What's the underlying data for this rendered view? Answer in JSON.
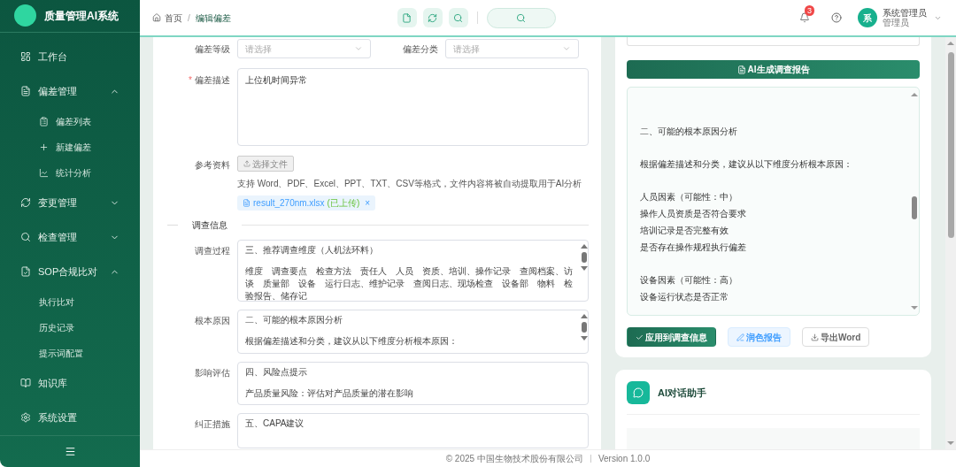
{
  "sidebar": {
    "title": "质量管理AI系统",
    "items": [
      {
        "label": "工作台"
      },
      {
        "label": "偏差管理",
        "expanded": true,
        "children": [
          {
            "label": "偏差列表"
          },
          {
            "label": "新建偏差"
          },
          {
            "label": "统计分析"
          }
        ]
      },
      {
        "label": "变更管理",
        "expanded": false
      },
      {
        "label": "检查管理",
        "expanded": false
      },
      {
        "label": "SOP合规比对",
        "expanded": true,
        "children": [
          {
            "label": "执行比对"
          },
          {
            "label": "历史记录"
          },
          {
            "label": "提示词配置"
          }
        ]
      },
      {
        "label": "知识库"
      },
      {
        "label": "系统设置"
      }
    ]
  },
  "header": {
    "breadcrumb": [
      "首页",
      "编辑偏差"
    ],
    "separator": "/",
    "notifications": "3",
    "user": {
      "avatar": "系",
      "name": "系统管理员",
      "role": "管理员"
    }
  },
  "form": {
    "selects": [
      {
        "label": "偏差等级",
        "placeholder": "请选择"
      },
      {
        "label": "偏差分类",
        "placeholder": "请选择"
      }
    ],
    "description": {
      "label": "偏差描述",
      "required_mark": "*",
      "value": "上位机时间异常"
    },
    "attachments": {
      "label": "参考资料",
      "button": "选择文件",
      "hint": "支持 Word、PDF、Excel、PPT、TXT、CSV等格式，文件内容将被自动提取用于AI分析",
      "file": "result_270nm.xlsx",
      "file_status": "(已上传)",
      "remove": "×"
    },
    "section": "调查信息",
    "fields": [
      {
        "label": "调查过程",
        "paragraphs": [
          "三、推荐调查维度（人机法环料）",
          "维度　调查要点　检查方法　责任人　人员　资质、培训、操作记录　查阅档案、访谈　质量部　设备　运行日志、维护记录　查阅日志、现场检查　设备部　物料　检验报告、储存记"
        ],
        "scrollbar": true
      },
      {
        "label": "根本原因",
        "paragraphs": [
          "二、可能的根本原因分析",
          "根据偏差描述和分类，建议从以下维度分析根本原因："
        ],
        "scrollbar": true
      },
      {
        "label": "影响评估",
        "paragraphs": [
          "四、风险点提示",
          "产品质量风险：评估对产品质量的潜在影响"
        ],
        "scrollbar": false
      },
      {
        "label": "纠正措施",
        "paragraphs": [
          "五、CAPA建议"
        ],
        "scrollbar": false
      }
    ]
  },
  "ai_panel": {
    "generate_button": "AI生成调查报告",
    "report": [
      [
        "二、可能的根本原因分析"
      ],
      [
        "根据偏差描述和分类，建议从以下维度分析根本原因："
      ],
      [
        "人员因素（可能性：中）",
        "操作人员资质是否符合要求",
        "培训记录是否完整有效",
        "是否存在操作规程执行偏差"
      ],
      [
        "设备因素（可能性：高）",
        "设备运行状态是否正常"
      ]
    ],
    "actions": [
      {
        "label": "应用到调查信息",
        "kind": "primary"
      },
      {
        "label": "润色报告",
        "kind": "soft"
      },
      {
        "label": "导出Word",
        "kind": "plain"
      }
    ],
    "chat_title": "AI对话助手"
  },
  "footer": {
    "copyright": "© 2025 中国生物技术股份有限公司",
    "version": "Version 1.0.0"
  }
}
